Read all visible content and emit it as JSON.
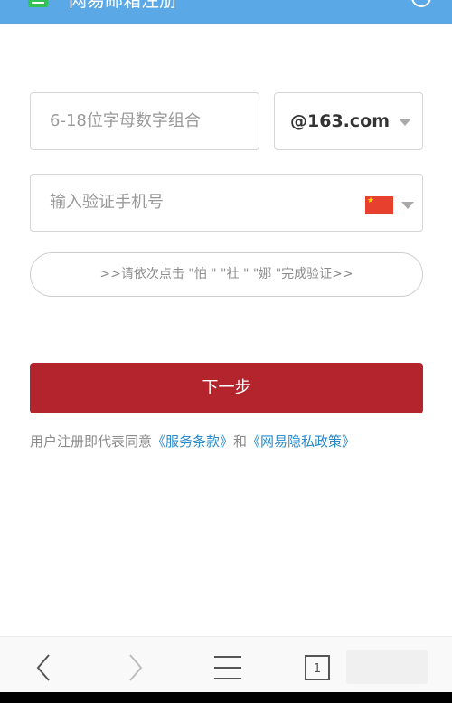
{
  "header": {
    "title": "网易邮箱注册",
    "icon": "mail-icon",
    "close_icon": "close-circle-icon"
  },
  "form": {
    "username_placeholder": "6-18位字母数字组合",
    "domain_selected": "@163.com",
    "phone_placeholder": "输入验证手机号",
    "country_flag": "china-flag-icon"
  },
  "captcha": {
    "text": ">>请依次点击 \"怕 \" \"社 \" \"娜 \"完成验证>>"
  },
  "next_button": {
    "label": "下一步"
  },
  "agreement": {
    "prefix": "用户注册即代表同意",
    "terms_link": "《服务条款》",
    "and": "和",
    "privacy_link": "《网易隐私政策》"
  },
  "bottom_nav": {
    "tab_count": "1",
    "icons": [
      "back-icon",
      "forward-icon",
      "menu-icon",
      "tabs-icon"
    ]
  },
  "colors": {
    "primary_red": "#b3242d",
    "link_blue": "#2a8ac9",
    "banner_blue": "#5aa9e6"
  }
}
